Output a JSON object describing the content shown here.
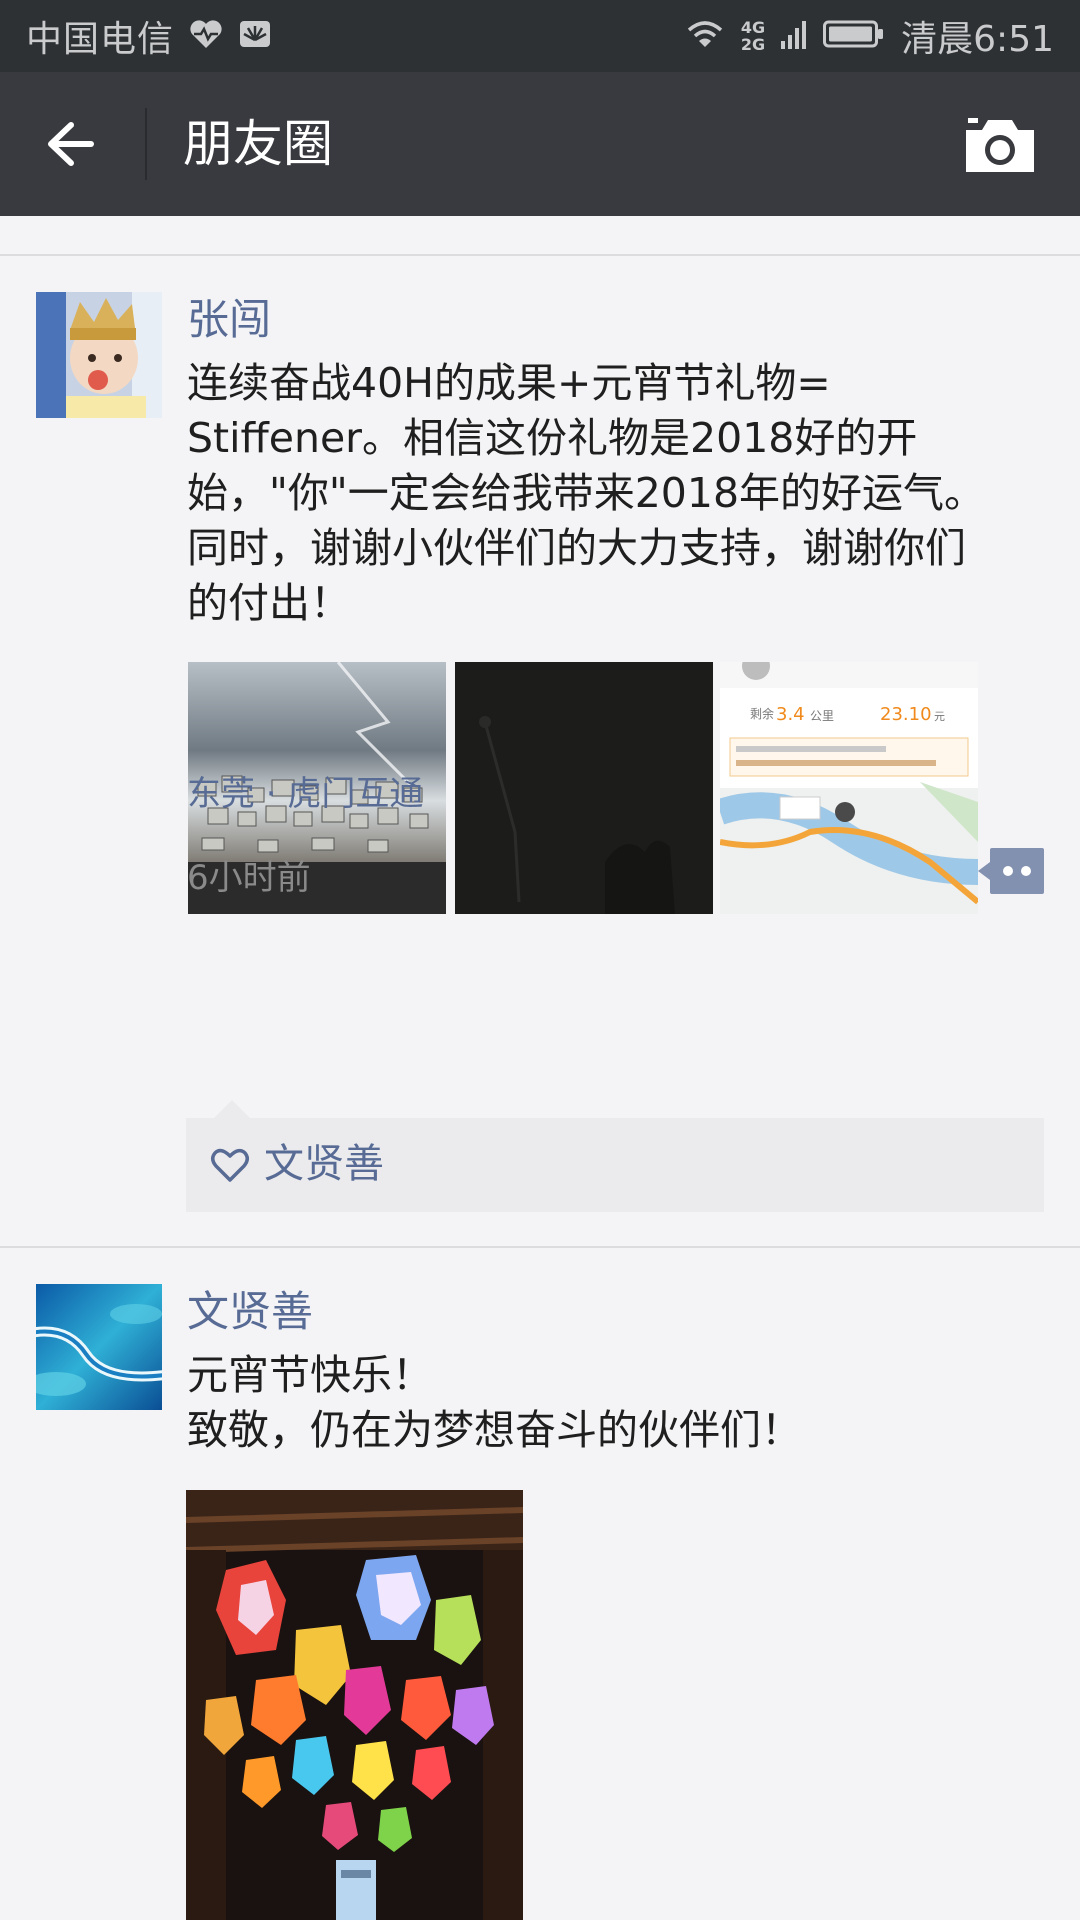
{
  "status_bar": {
    "carrier": "中国电信",
    "network_top": "4G",
    "network_bottom": "2G",
    "time": "清晨6:51",
    "icons": [
      "heartbeat-icon",
      "huawei-icon",
      "wifi-icon",
      "signal-icon",
      "battery-icon"
    ]
  },
  "title_bar": {
    "title": "朋友圈",
    "back_icon": "back-arrow-icon",
    "camera_icon": "camera-icon"
  },
  "posts": [
    {
      "author": "张闯",
      "text": "连续奋战40H的成果+元宵节礼物=\nStiffener。相信这份礼物是2018好的开\n始，\"你\"一定会给我带来2018年的好运气。\n同时，谢谢小伙伴们的大力支持，谢谢你们\n的付出！",
      "images": [
        {
          "kind": "photo-factory-parts"
        },
        {
          "kind": "photo-dark-night"
        },
        {
          "kind": "screenshot-map",
          "distance_label": "剩余",
          "distance": "3.4",
          "distance_unit": "公里",
          "price": "23.10",
          "price_unit": "元"
        }
      ],
      "location": "东莞 · 虎门互通",
      "time_ago": "6小时前",
      "likes": [
        "文贤善"
      ]
    },
    {
      "author": "文贤善",
      "text": "元宵节快乐！\n致敬，仍在为梦想奋斗的伙伴们！",
      "images": [
        {
          "kind": "photo-lanterns"
        }
      ]
    }
  ]
}
